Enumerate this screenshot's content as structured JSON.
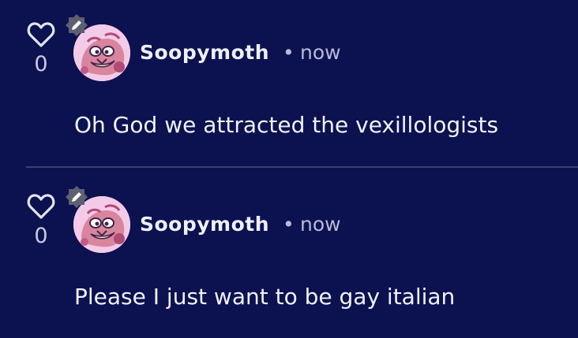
{
  "comments": [
    {
      "likes": "0",
      "author": "Soopymoth",
      "separator": "•",
      "time": "now",
      "text": "Oh God we attracted the vexillologists"
    },
    {
      "likes": "0",
      "author": "Soopymoth",
      "separator": "•",
      "time": "now",
      "text": "Please I just want to be gay italian"
    }
  ],
  "icons": {
    "like": "heart-outline-icon",
    "edit": "pencil-icon"
  },
  "colors": {
    "background": "#0c1150",
    "text": "#f1f2fb",
    "muted": "#b8bbd6",
    "divider": "#3a4170",
    "avatar_bg": "#f0c8e6"
  }
}
